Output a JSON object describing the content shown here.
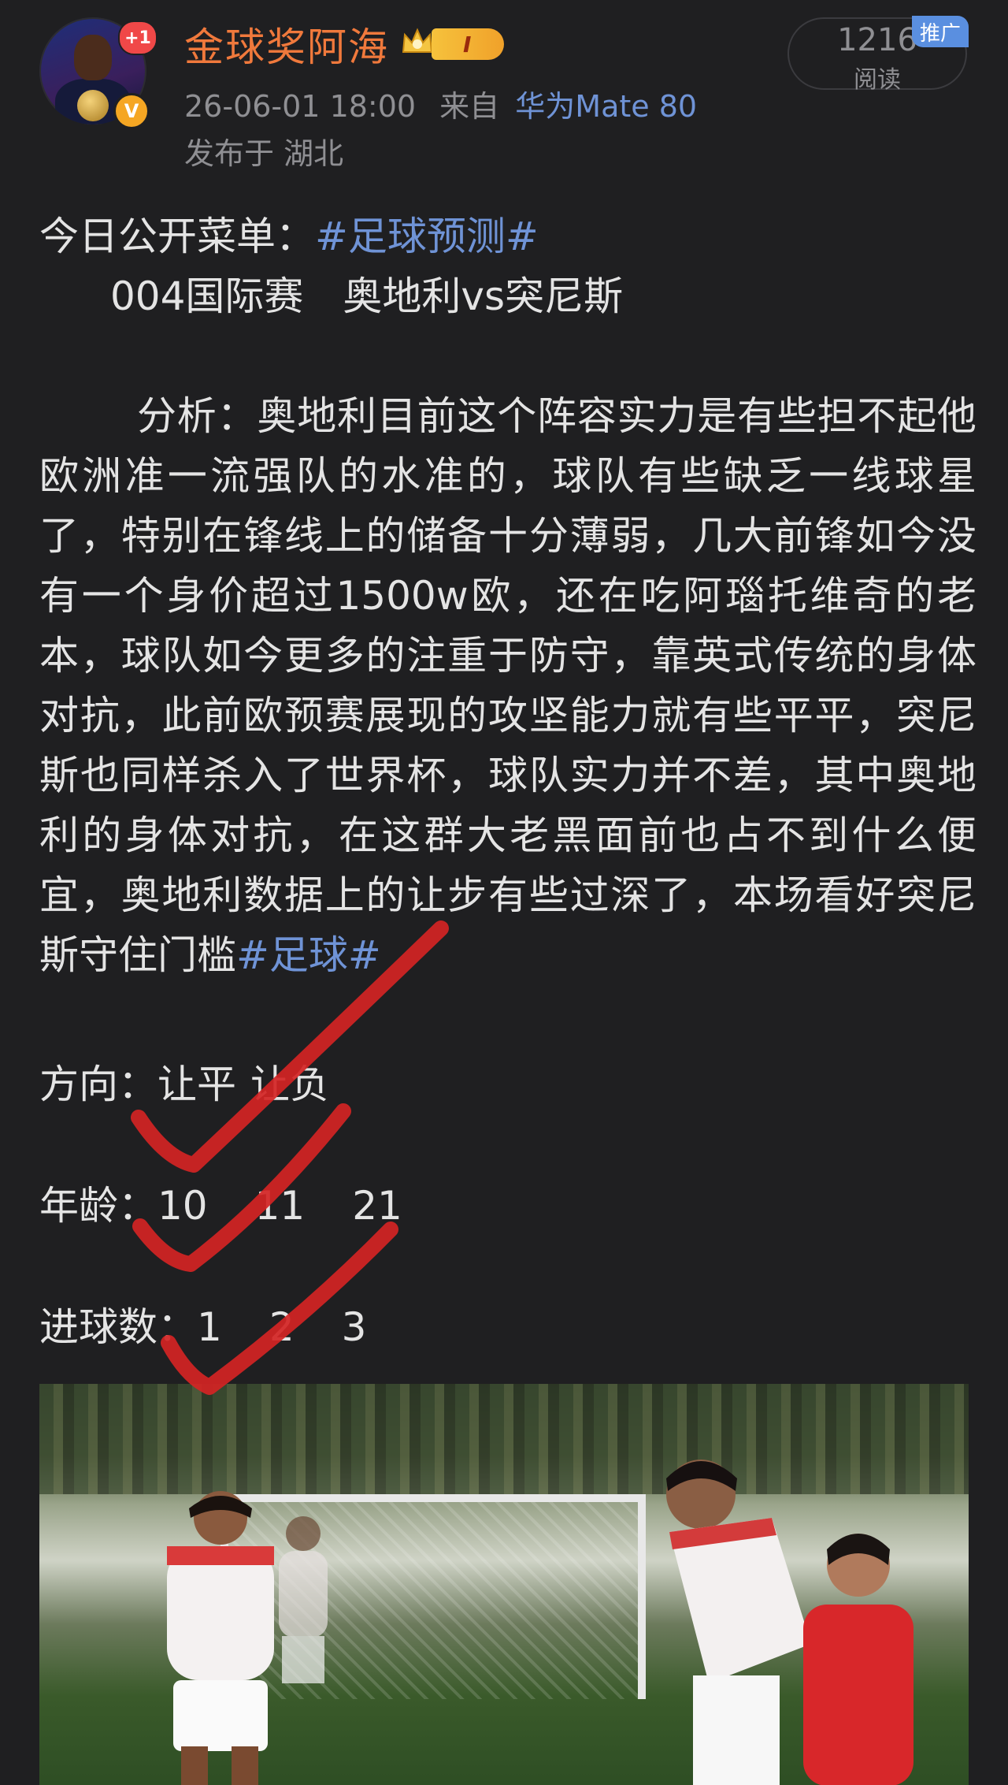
{
  "header": {
    "username": "金球奖阿海",
    "notification_badge": "+1",
    "verified_badge": "V",
    "level_badge": "I",
    "timestamp": "26-06-01 18:00",
    "source_prefix": "来自",
    "device": "华为Mate 80",
    "location": "发布于 湖北",
    "read_count": "1216",
    "read_label": "阅读",
    "promo_label": "推广"
  },
  "post": {
    "title_prefix": "今日公开菜单：",
    "title_tag": "#足球预测#",
    "match_line": "004国际赛　奥地利vs突尼斯",
    "analysis_text": "分析：奥地利目前这个阵容实力是有些担不起他欧洲准一流强队的水准的，球队有些缺乏一线球星了，特别在锋线上的储备十分薄弱，几大前锋如今没有一个身价超过1500w欧，还在吃阿瑙托维奇的老本，球队如今更多的注重于防守，靠英式传统的身体对抗，此前欧预赛展现的攻坚能力就有些平平，突尼斯也同样杀入了世界杯，球队实力并不差，其中奥地利的身体对抗，在这群大老黑面前也占不到什么便宜，奥地利数据上的让步有些过深了，本场看好突尼斯守住门槛",
    "analysis_tag": "#足球#",
    "direction_label": "方向：",
    "direction_values": [
      "让平",
      "让负"
    ],
    "age_label": "年龄：",
    "age_values": [
      "10",
      "11",
      "21"
    ],
    "goals_label": "进球数：",
    "goals_values": [
      "1",
      "2",
      "3"
    ]
  },
  "colors": {
    "background": "#1f1f21",
    "username": "#f0793c",
    "link": "#6f93d6",
    "muted": "#8f8f93",
    "check_mark": "#d42424"
  }
}
